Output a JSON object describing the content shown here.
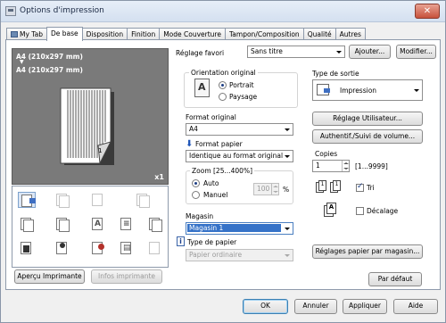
{
  "window": {
    "title": "Options d'impression",
    "close_label": "✕"
  },
  "tabs": [
    "My Tab",
    "De base",
    "Disposition",
    "Finition",
    "Mode Couverture",
    "Tampon/Composition",
    "Qualité",
    "Autres"
  ],
  "preview": {
    "size1": "A4 (210x297 mm)",
    "arrow": "▼",
    "size2": "A4 (210x297 mm)",
    "copies_badge": "x1",
    "page_number": "1"
  },
  "left_buttons": {
    "apercu": "Aperçu Imprimante",
    "infos": "Infos imprimante"
  },
  "favorites": {
    "label": "Réglage favori",
    "value": "Sans titre",
    "add": "Ajouter...",
    "modify": "Modifier..."
  },
  "orientation": {
    "title": "Orientation original",
    "portrait": "Portrait",
    "paysage": "Paysage",
    "selected": "Portrait"
  },
  "format_original": {
    "label": "Format original",
    "value": "A4"
  },
  "format_papier": {
    "label": "Format papier",
    "value": "Identique au format original"
  },
  "zoom": {
    "title": "Zoom [25...400%]",
    "auto": "Auto",
    "manuel": "Manuel",
    "value": "100",
    "unit": "%",
    "selected": "Auto"
  },
  "magasin": {
    "label": "Magasin",
    "value": "Magasin 1"
  },
  "type_papier": {
    "label": "Type de papier",
    "value": "Papier ordinaire"
  },
  "type_sortie": {
    "label": "Type de sortie",
    "value": "Impression"
  },
  "right_buttons": {
    "reglage_utilisateur": "Réglage Utilisateur...",
    "authentif": "Authentif./Suivi de volume...",
    "reglages_papier": "Réglages papier par magasin..."
  },
  "copies": {
    "label": "Copies",
    "value": "1",
    "range": "[1...9999]"
  },
  "tri": {
    "label": "Tri",
    "checked": true
  },
  "decalage": {
    "label": "Décalage",
    "checked": false
  },
  "par_defaut": "Par défaut",
  "footer": {
    "ok": "OK",
    "annuler": "Annuler",
    "appliquer": "Appliquer",
    "aide": "Aide"
  }
}
